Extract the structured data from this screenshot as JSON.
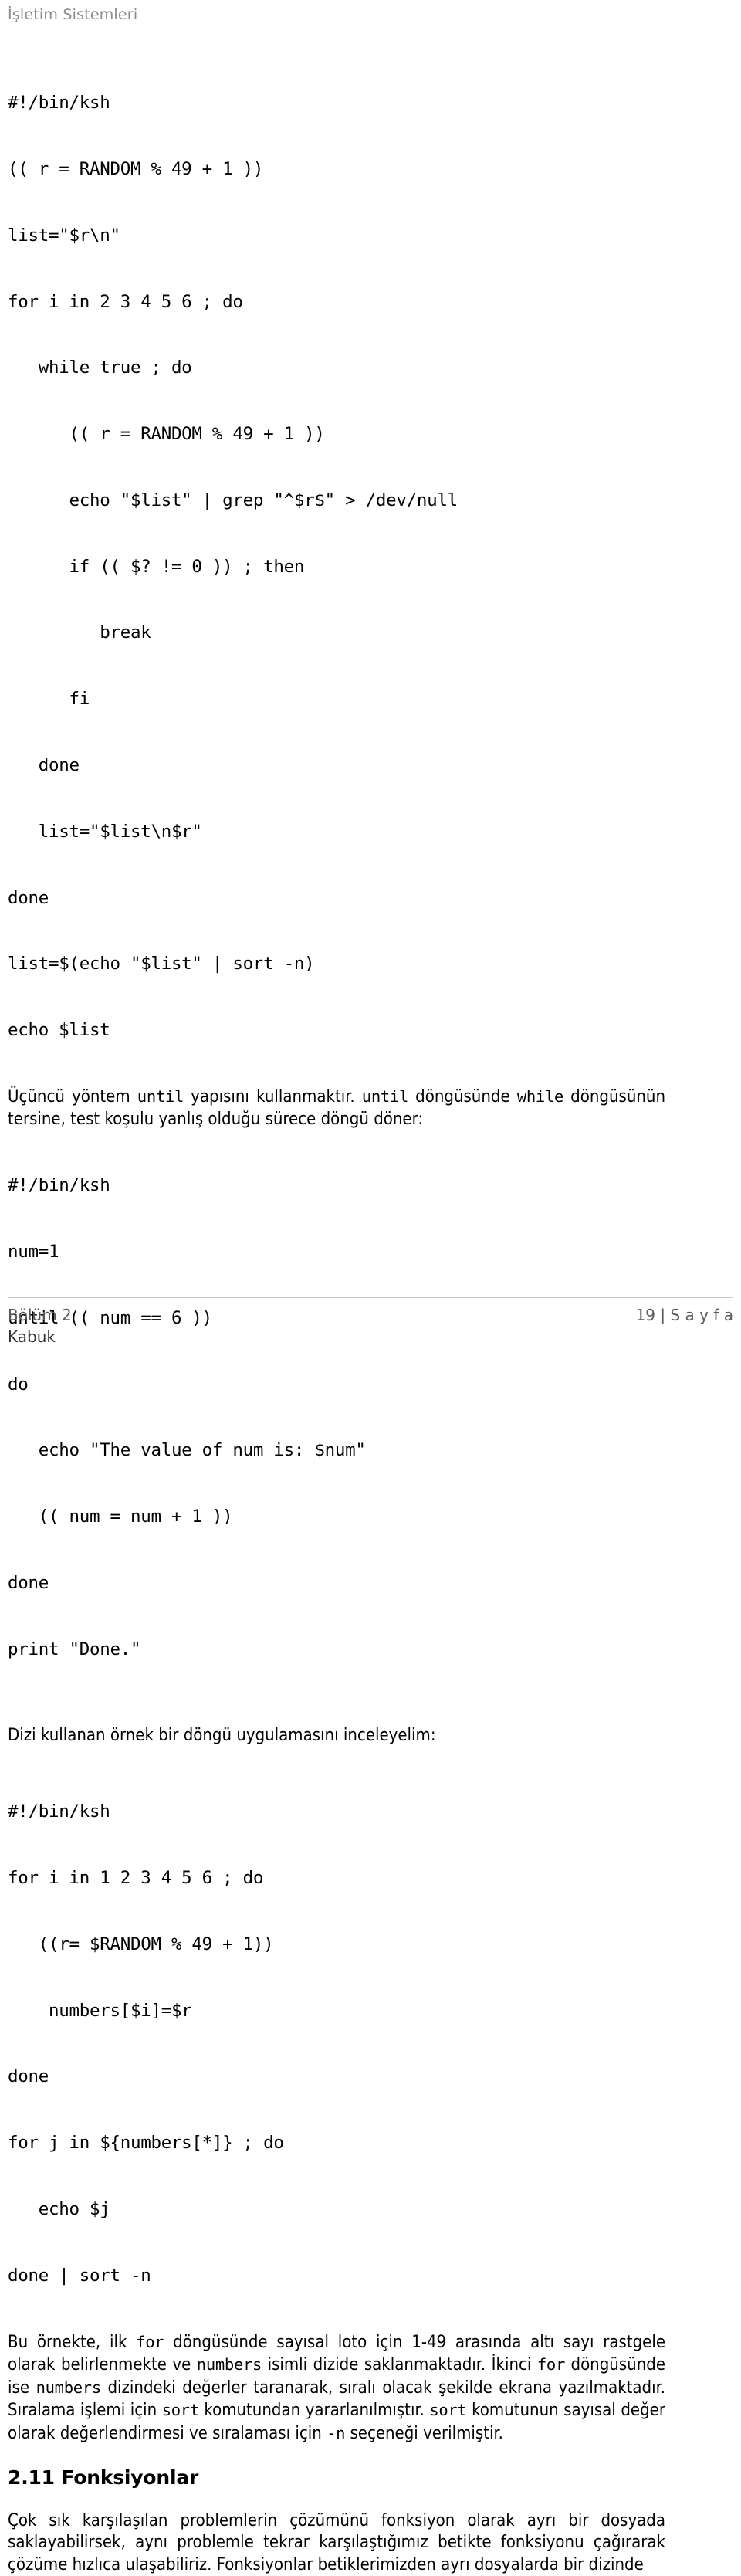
{
  "running_head": "İşletim Sistemleri",
  "code_block_1": [
    "#!/bin/ksh",
    "(( r = RANDOM % 49 + 1 ))",
    "list=\"$r\\n\"",
    "for i in 2 3 4 5 6 ; do",
    "   while true ; do",
    "      (( r = RANDOM % 49 + 1 ))",
    "      echo \"$list\" | grep \"^$r$\" > /dev/null",
    "      if (( $? != 0 )) ; then",
    "         break",
    "      fi",
    "   done",
    "   list=\"$list\\n$r\"",
    "done",
    "list=$(echo \"$list\" | sort -n)",
    "echo $list"
  ],
  "paragraph_1": {
    "part_1": "Üçüncü yöntem ",
    "mono_1": "until",
    "part_2": " yapısını kullanmaktır. ",
    "mono_2": "until",
    "part_3": " döngüsünde ",
    "mono_3": "while",
    "part_4": " döngüsünün tersine, test koşulu yanlış olduğu sürece döngü döner:"
  },
  "code_block_2": [
    "#!/bin/ksh",
    "num=1",
    "until (( num == 6 ))",
    "do",
    "   echo \"The value of num is: $num\"",
    "   (( num = num + 1 ))",
    "done",
    "print \"Done.\""
  ],
  "paragraph_2": "Dizi kullanan örnek bir döngü uygulamasını inceleyelim:",
  "code_block_3": [
    "#!/bin/ksh",
    "for i in 1 2 3 4 5 6 ; do",
    "   ((r= $RANDOM % 49 + 1))",
    "    numbers[$i]=$r",
    "done",
    "for j in ${numbers[*]} ; do",
    "   echo $j",
    "done | sort -n"
  ],
  "paragraph_3": {
    "part_1": "Bu örnekte, ilk ",
    "mono_1": "for",
    "part_2": " döngüsünde sayısal loto için 1-49 arasında altı sayı rastgele olarak belirlenmekte ve ",
    "mono_2": "numbers",
    "part_3": " isimli dizide saklanmaktadır. İkinci ",
    "mono_3": "for",
    "part_4": " döngüsünde ise ",
    "mono_4": "numbers",
    "part_5": " dizindeki değerler taranarak, sıralı olacak şekilde ekrana yazılmaktadır. Sıralama işlemi için ",
    "mono_5": "sort",
    "part_6": " komutundan yararlanılmıştır. ",
    "mono_6": "sort",
    "part_7": " komutunun sayısal değer olarak değerlendirmesi ve sıralaması için ",
    "mono_7": "-n",
    "part_8": " seçeneği verilmiştir."
  },
  "heading": "2.11 Fonksiyonlar",
  "paragraph_4": "Çok sık karşılaşılan problemlerin çözümünü fonksiyon olarak ayrı bir dosyada saklayabilirsek, aynı problemle tekrar karşılaştığımız betikte fonksiyonu çağırarak çözüme hızlıca ulaşabiliriz. Fonksiyonlar betiklerimizden ayrı dosyalarda bir dizinde",
  "footer": {
    "chapter": "Bölüm 2",
    "section": "Kabuk",
    "page_label": "19 | S a y f a"
  },
  "colors": {
    "running_head": "#8a8a8a",
    "text": "#000000",
    "footer_text": "#595959",
    "rule": "#c8c8c8"
  }
}
